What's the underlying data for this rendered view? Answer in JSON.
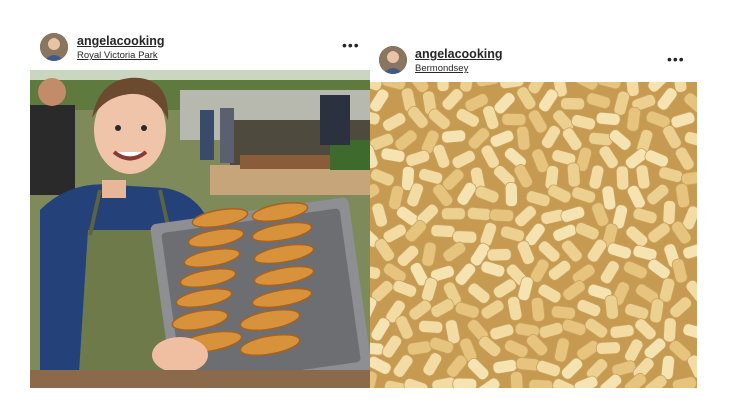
{
  "posts": [
    {
      "username": "angelacooking",
      "location": "Royal Victoria Park",
      "more_icon": "more-horizontal-icon",
      "photo_subject": "chef-holding-tray-of-pasties"
    },
    {
      "username": "angelacooking",
      "location": "Bermondsey",
      "more_icon": "more-horizontal-icon",
      "photo_subject": "rigatoni-pasta-closeup"
    }
  ],
  "colors": {
    "text": "#262626",
    "background": "#ffffff",
    "pastry": "#d9923c",
    "pasta": "#f0d79a"
  }
}
